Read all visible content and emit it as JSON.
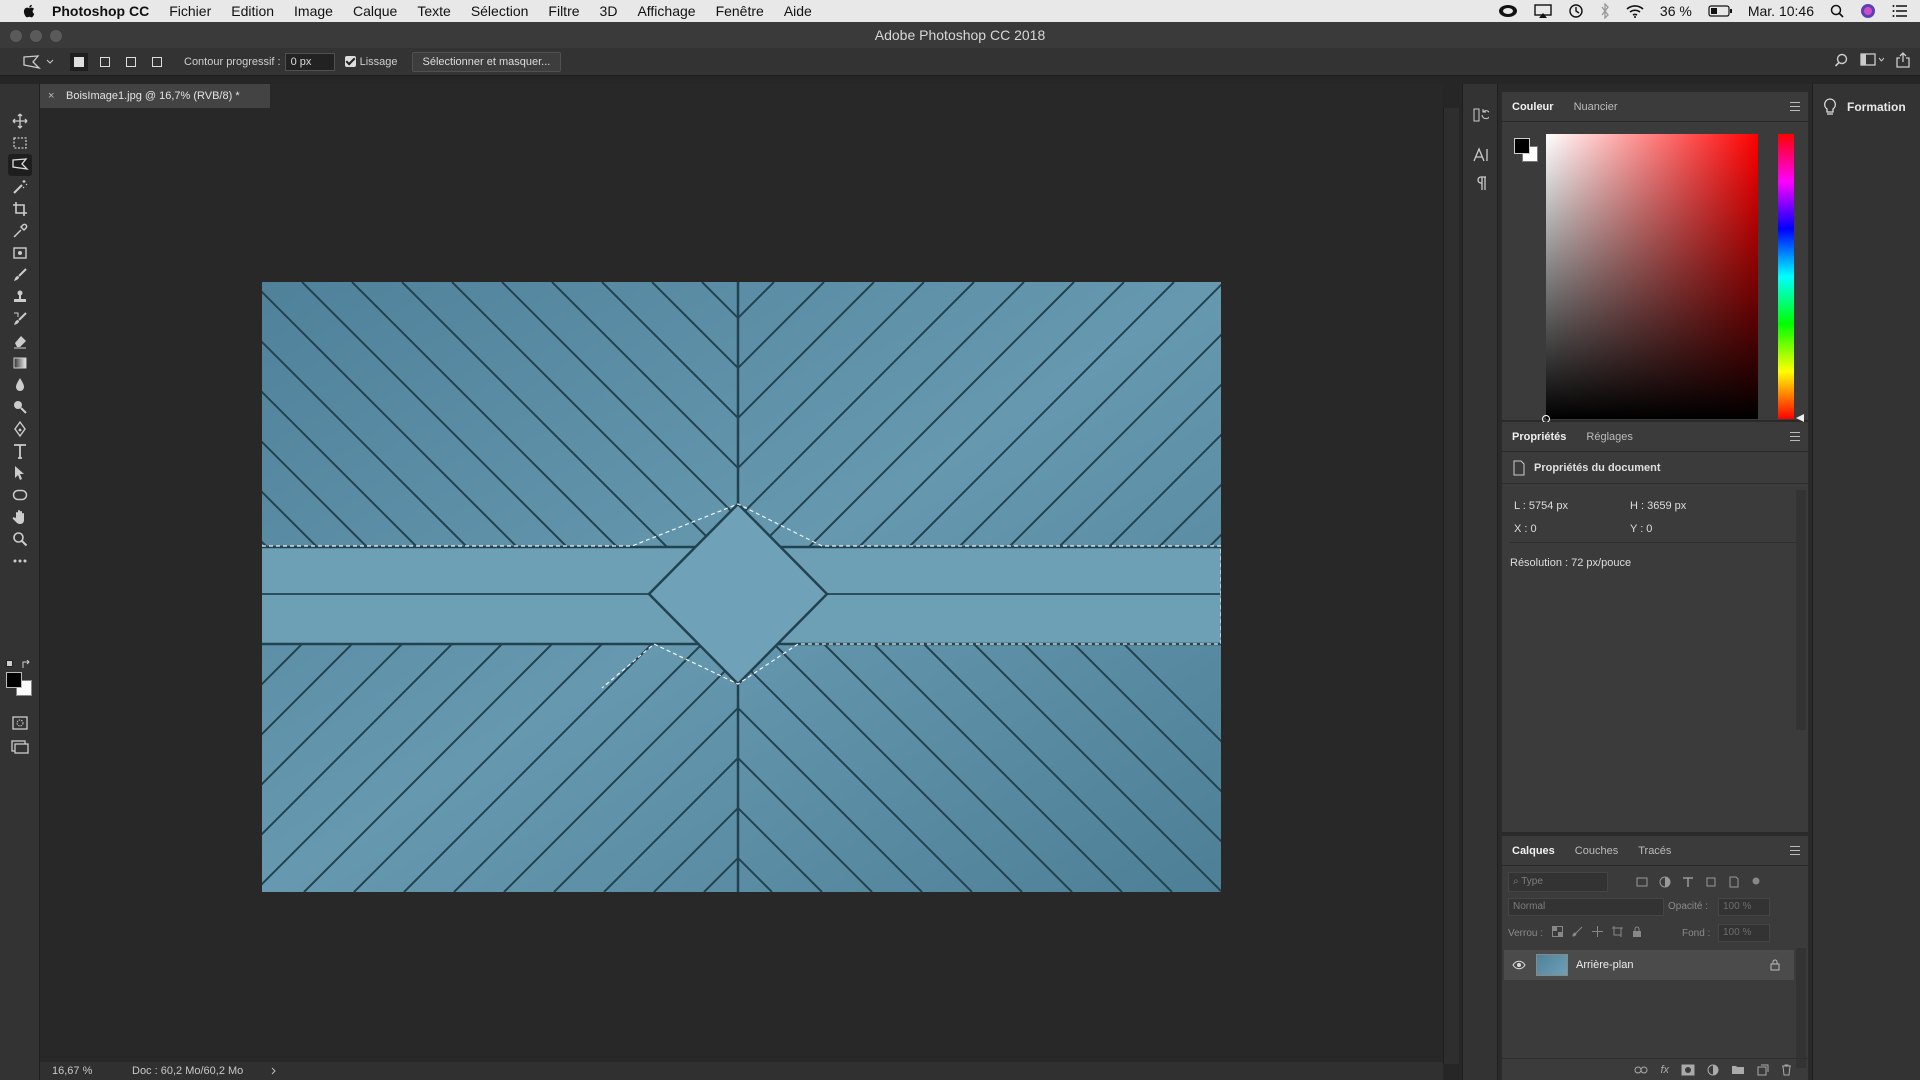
{
  "menubar": {
    "app_name": "Photoshop CC",
    "items": [
      "Fichier",
      "Edition",
      "Image",
      "Calque",
      "Texte",
      "Sélection",
      "Filtre",
      "3D",
      "Affichage",
      "Fenêtre",
      "Aide"
    ],
    "battery": "36 %",
    "clock": "Mar. 10:46"
  },
  "window": {
    "title": "Adobe Photoshop CC 2018"
  },
  "options_bar": {
    "feather_label": "Contour progressif :",
    "feather_value": "0 px",
    "antialias_label": "Lissage",
    "antialias_checked": true,
    "select_mask_button": "Sélectionner et masquer..."
  },
  "toolbar": {
    "active_tool": "polygonal-lasso",
    "tools": [
      "move",
      "rect-marquee",
      "polygonal-lasso",
      "magic-wand",
      "crop",
      "eyedropper",
      "patch",
      "brush",
      "clone-stamp",
      "history-brush",
      "eraser",
      "gradient",
      "blur",
      "dodge",
      "pen",
      "type",
      "path-selection",
      "ellipse",
      "hand",
      "zoom",
      "more"
    ],
    "foreground_color": "#000000",
    "background_color": "#ffffff"
  },
  "document": {
    "tab_label": "BoisImage1.jpg @ 16,7% (RVB/8) *",
    "zoom": "16,67 %",
    "doc_info": "Doc : 60,2 Mo/60,2 Mo"
  },
  "color_panel": {
    "tabs": [
      "Couleur",
      "Nuancier"
    ],
    "active_tab": "Couleur",
    "hue_color": "#ff0000"
  },
  "properties_panel": {
    "tabs": [
      "Propriétés",
      "Réglages"
    ],
    "active_tab": "Propriétés",
    "heading": "Propriétés du document",
    "width": "L : 5754 px",
    "height": "H : 3659 px",
    "x": "X : 0",
    "y": "Y : 0",
    "resolution": "Résolution : 72 px/pouce"
  },
  "layers_panel": {
    "tabs": [
      "Calques",
      "Couches",
      "Tracés"
    ],
    "active_tab": "Calques",
    "filter_placeholder": "Type",
    "blend_mode": "Normal",
    "opacity_label": "Opacité :",
    "opacity_value": "100 %",
    "lock_label": "Verrou :",
    "fill_label": "Fond :",
    "fill_value": "100 %",
    "layers": [
      {
        "name": "Arrière-plan",
        "visible": true,
        "locked": true
      }
    ]
  },
  "training": {
    "label": "Formation"
  },
  "colors": {
    "accent_selected": "#1e1e1e",
    "panel_bg": "#3b3b3b",
    "wood": "#5e91a8"
  }
}
